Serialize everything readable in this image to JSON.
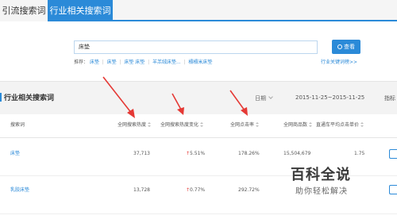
{
  "tabs": [
    {
      "label": "引流搜索词",
      "active": false
    },
    {
      "label": "行业相关搜索词",
      "active": true
    }
  ],
  "search": {
    "value": "床垫",
    "button_label": "查看"
  },
  "recommendations": {
    "label": "推荐：",
    "items": [
      "床垫",
      "床垫",
      "床垫 床垫",
      "羊羔绒床垫...",
      "榻榻米床垫"
    ]
  },
  "detail_link": "行业关键词榜>>",
  "section": {
    "title": "行业相关搜索词",
    "date_label": "日期",
    "date_range": "2015-11-25~2015-11-25",
    "indicator_label": "指标"
  },
  "table": {
    "headers": {
      "keyword": "搜索词",
      "search_heat": "全网搜索热度",
      "heat_change": "全网搜索热度变化",
      "ctr": "全网点击率",
      "product_count": "全网商品数",
      "avg_price": "直通车平均点击单价"
    },
    "rows": [
      {
        "keyword": "床垫",
        "search_heat": "37,713",
        "heat_change": "5.51%",
        "ctr": "178.26%",
        "product_count": "15,504,679",
        "avg_price": "1.75"
      },
      {
        "keyword": "乳胶床垫",
        "search_heat": "13,728",
        "heat_change": "0.77%",
        "ctr": "292.72%",
        "product_count": "",
        "avg_price": ""
      }
    ]
  },
  "watermark": {
    "title": "百科全说",
    "subtitle": "助你轻松解决"
  },
  "colors": {
    "accent": "#2b8ad8",
    "increase": "#e53935",
    "annotation_arrow": "#e53935"
  }
}
